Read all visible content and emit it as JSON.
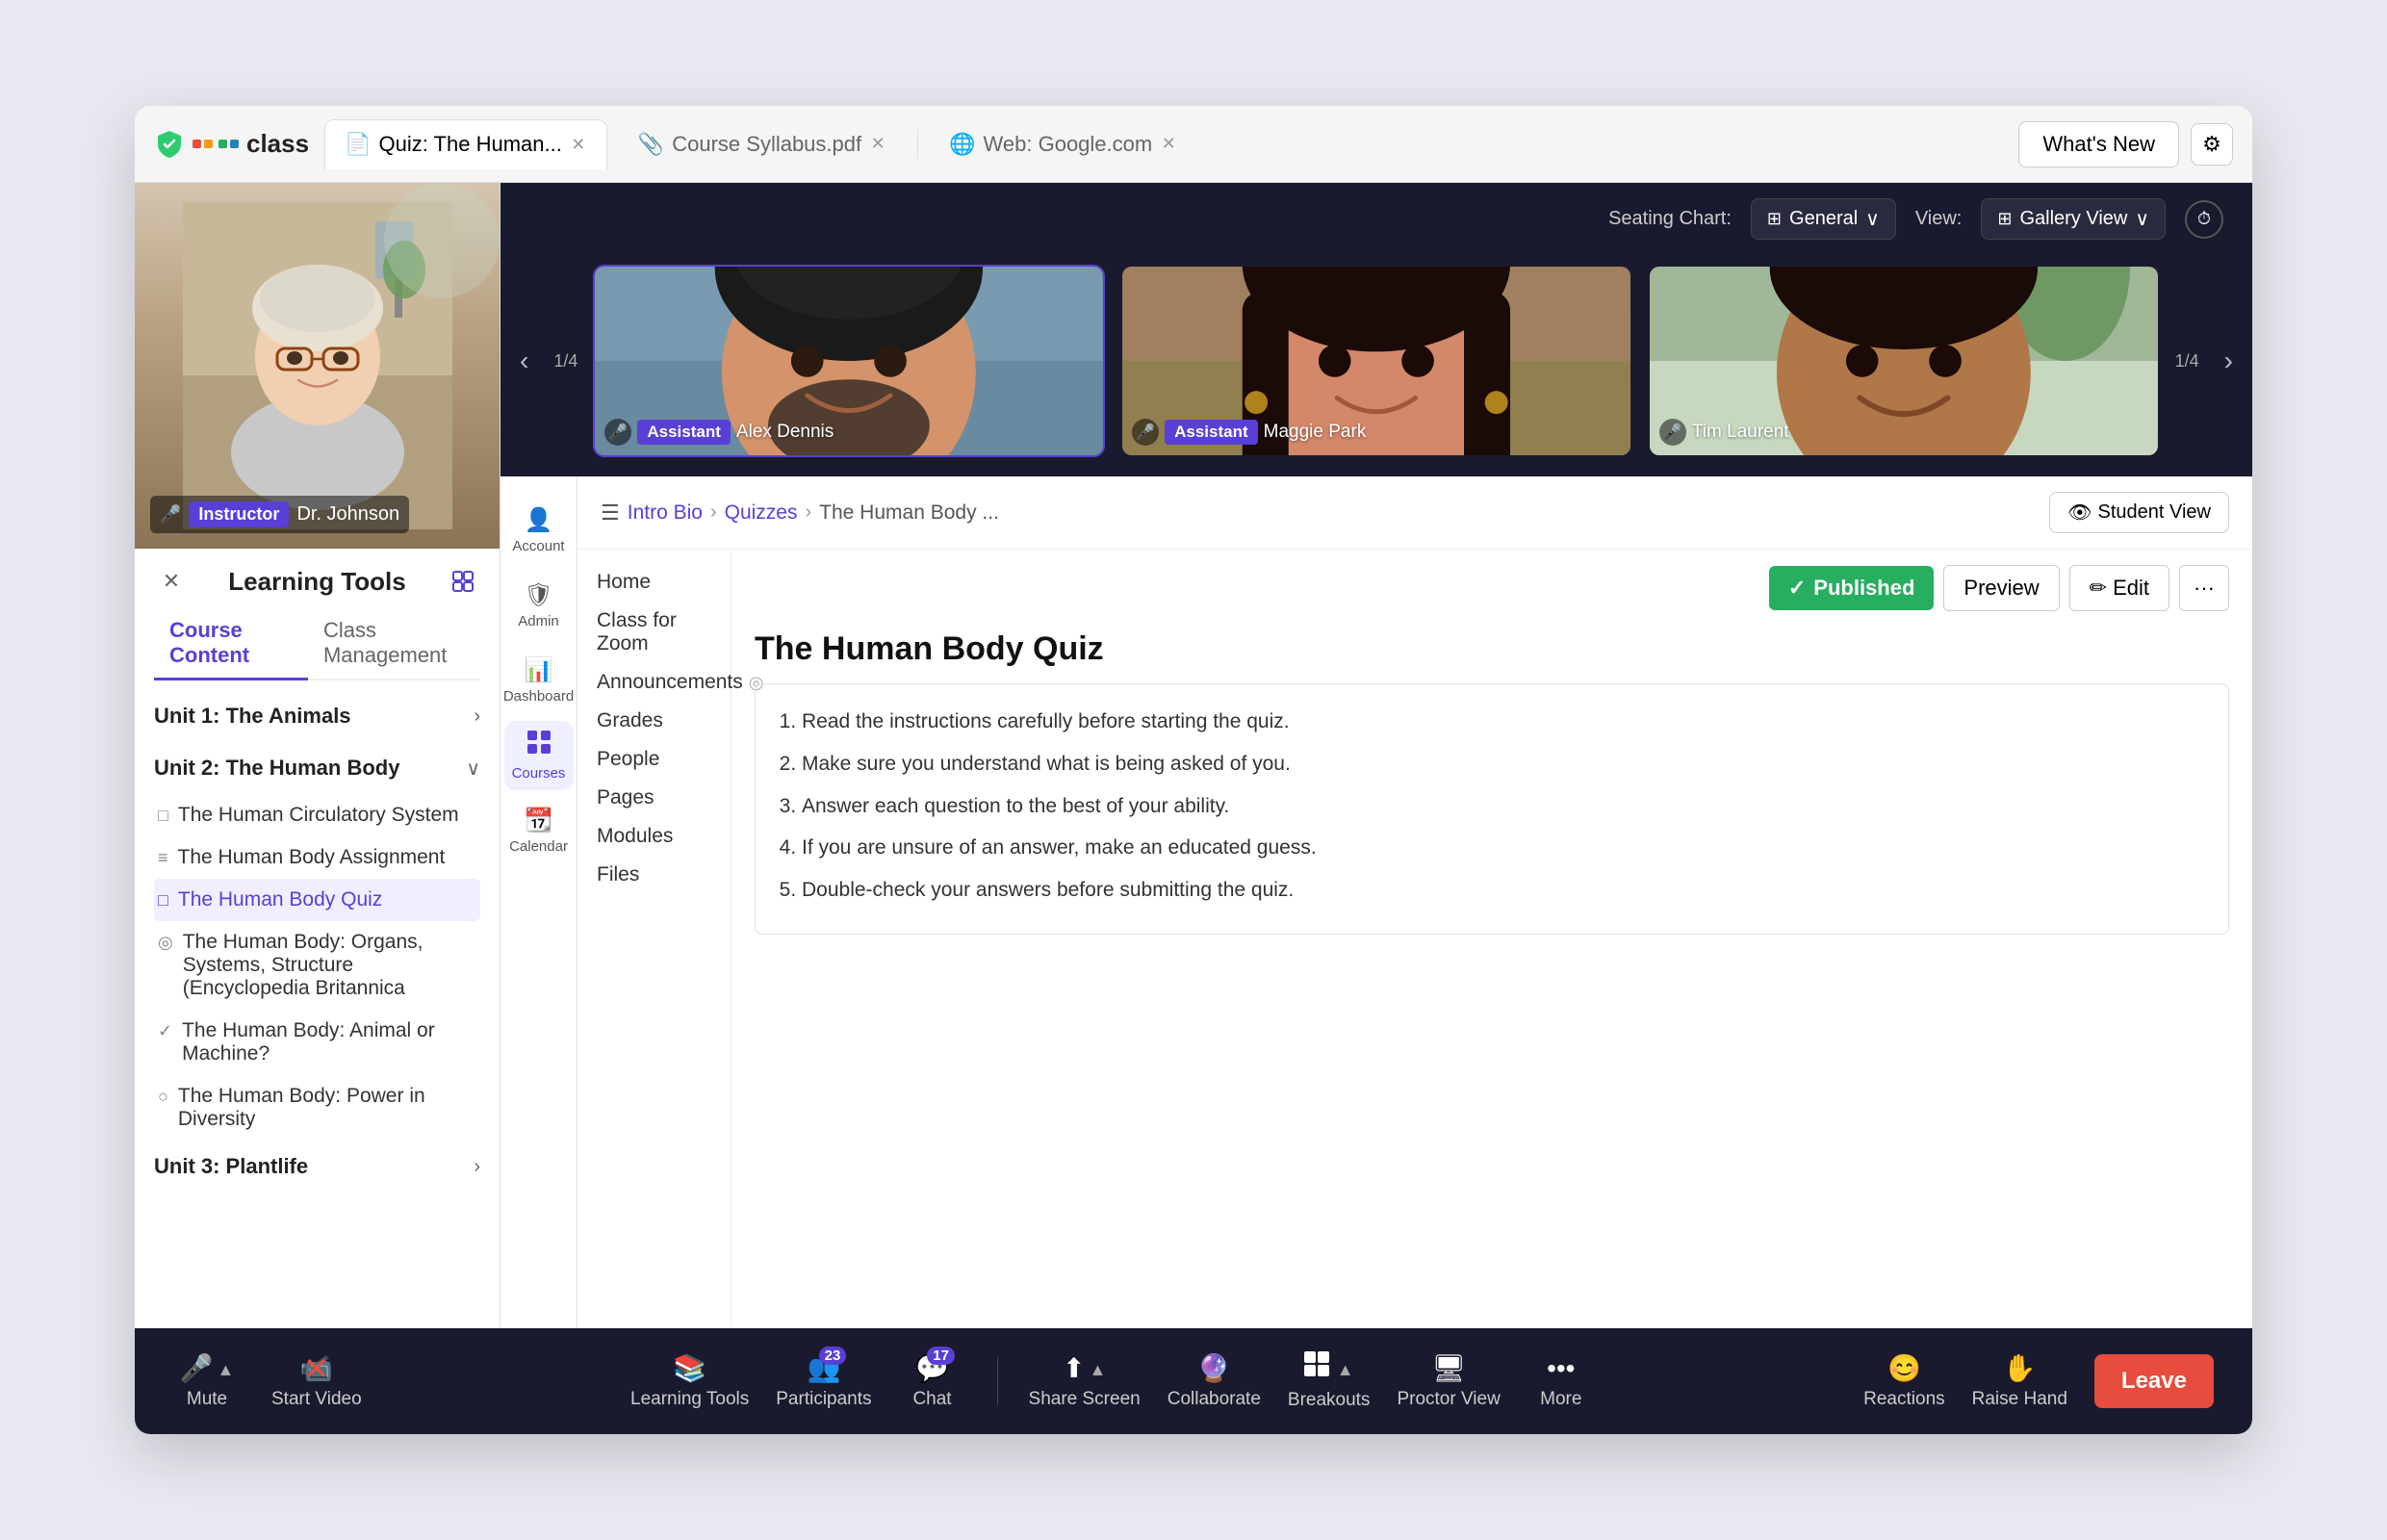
{
  "browser": {
    "tabs": [
      {
        "id": "quiz",
        "label": "Quiz: The Human...",
        "active": true,
        "icon": "📄"
      },
      {
        "id": "syllabus",
        "label": "Course Syllabus.pdf",
        "active": false,
        "icon": "📎"
      },
      {
        "id": "google",
        "label": "Web: Google.com",
        "active": false,
        "icon": "🌐"
      }
    ],
    "whats_new": "What's New",
    "gear_icon": "⚙"
  },
  "instructor": {
    "badge": "Instructor",
    "name": "Dr. Johnson"
  },
  "learning_tools": {
    "title": "Learning Tools",
    "close_icon": "✕",
    "expand_icon": "⬡",
    "tabs": [
      {
        "id": "course",
        "label": "Course Content",
        "active": true
      },
      {
        "id": "class",
        "label": "Class Management",
        "active": false
      }
    ],
    "units": [
      {
        "id": "unit1",
        "title": "Unit 1: The Animals",
        "expanded": false,
        "items": []
      },
      {
        "id": "unit2",
        "title": "Unit 2: The Human Body",
        "expanded": true,
        "items": [
          {
            "id": "item1",
            "icon": "doc",
            "label": "The Human Circulatory System",
            "active": false
          },
          {
            "id": "item2",
            "icon": "list",
            "label": "The Human Body Assignment",
            "active": false
          },
          {
            "id": "item3",
            "icon": "doc",
            "label": "The Human Body Quiz",
            "active": true
          },
          {
            "id": "item4",
            "icon": "eye",
            "label": "The Human Body: Organs, Systems, Structure (Encyclopedia Britannica",
            "active": false
          },
          {
            "id": "item5",
            "icon": "check",
            "label": "The Human Body: Animal or Machine?",
            "active": false
          },
          {
            "id": "item6",
            "icon": "circle",
            "label": "The Human Body: Power in Diversity",
            "active": false
          }
        ]
      },
      {
        "id": "unit3",
        "title": "Unit 3: Plantlife",
        "expanded": false,
        "items": []
      }
    ]
  },
  "gallery": {
    "seating_label": "Seating Chart:",
    "seating_value": "General",
    "view_label": "View:",
    "view_value": "Gallery View",
    "counter_left": "1/4",
    "counter_right": "1/4",
    "participants": [
      {
        "id": "alex",
        "name": "Alex Dennis",
        "badge": "Assistant",
        "highlighted": true,
        "bg_class": "alex-photo"
      },
      {
        "id": "maggie",
        "name": "Maggie Park",
        "badge": "Assistant",
        "highlighted": false,
        "bg_class": "maggie-photo"
      },
      {
        "id": "tim",
        "name": "Tim Laurent",
        "badge": "",
        "highlighted": false,
        "bg_class": "tim-photo"
      }
    ]
  },
  "lms_nav": {
    "items": [
      {
        "id": "account",
        "icon": "👤",
        "label": "Account"
      },
      {
        "id": "admin",
        "icon": "🛡",
        "label": "Admin"
      },
      {
        "id": "dashboard",
        "icon": "📊",
        "label": "Dashboard"
      },
      {
        "id": "courses",
        "icon": "📅",
        "label": "Courses",
        "active": true
      },
      {
        "id": "calendar",
        "icon": "📆",
        "label": "Calendar"
      }
    ]
  },
  "lms": {
    "breadcrumb": {
      "menu_icon": "☰",
      "links": [
        "Intro Bio",
        "Quizzes"
      ],
      "current": "The Human Body ..."
    },
    "student_view_btn": "Student View",
    "side_links": [
      "Home",
      "Class for Zoom",
      "Announcements",
      "Grades",
      "People",
      "Pages",
      "Modules",
      "Files"
    ],
    "published_btn": "Published",
    "preview_btn": "Preview",
    "edit_btn": "Edit",
    "more_btn": "···",
    "quiz_title": "The Human Body Quiz",
    "instructions": [
      "Read the instructions carefully before starting the quiz.",
      "Make sure you understand what is being asked of you.",
      "Answer each question to the best of your ability.",
      "If you are unsure of an answer, make an educated guess.",
      "Double-check your answers before submitting the quiz."
    ]
  },
  "toolbar": {
    "items": [
      {
        "id": "mute",
        "icon": "🎤",
        "label": "Mute",
        "has_arrow": true,
        "badge": null
      },
      {
        "id": "video",
        "icon": "📹",
        "label": "Start Video",
        "has_arrow": false,
        "badge": null,
        "crossed": true
      },
      {
        "id": "learning",
        "icon": "📚",
        "label": "Learning Tools",
        "badge": null
      },
      {
        "id": "participants",
        "icon": "👥",
        "label": "Participants",
        "badge": "23"
      },
      {
        "id": "chat",
        "icon": "💬",
        "label": "Chat",
        "badge": "17"
      },
      {
        "id": "share",
        "icon": "⬆",
        "label": "Share Screen",
        "badge": null,
        "has_arrow": true
      },
      {
        "id": "collaborate",
        "icon": "🔮",
        "label": "Collaborate",
        "badge": null
      },
      {
        "id": "breakouts",
        "icon": "⊞",
        "label": "Breakouts",
        "badge": null,
        "has_arrow": true
      },
      {
        "id": "proctor",
        "icon": "🖥",
        "label": "Proctor View",
        "badge": null
      },
      {
        "id": "more",
        "icon": "···",
        "label": "More",
        "badge": null
      },
      {
        "id": "reactions",
        "icon": "😊",
        "label": "Reactions",
        "badge": null
      },
      {
        "id": "raise_hand",
        "icon": "✋",
        "label": "Raise Hand",
        "badge": null
      }
    ],
    "leave_btn": "Leave"
  }
}
